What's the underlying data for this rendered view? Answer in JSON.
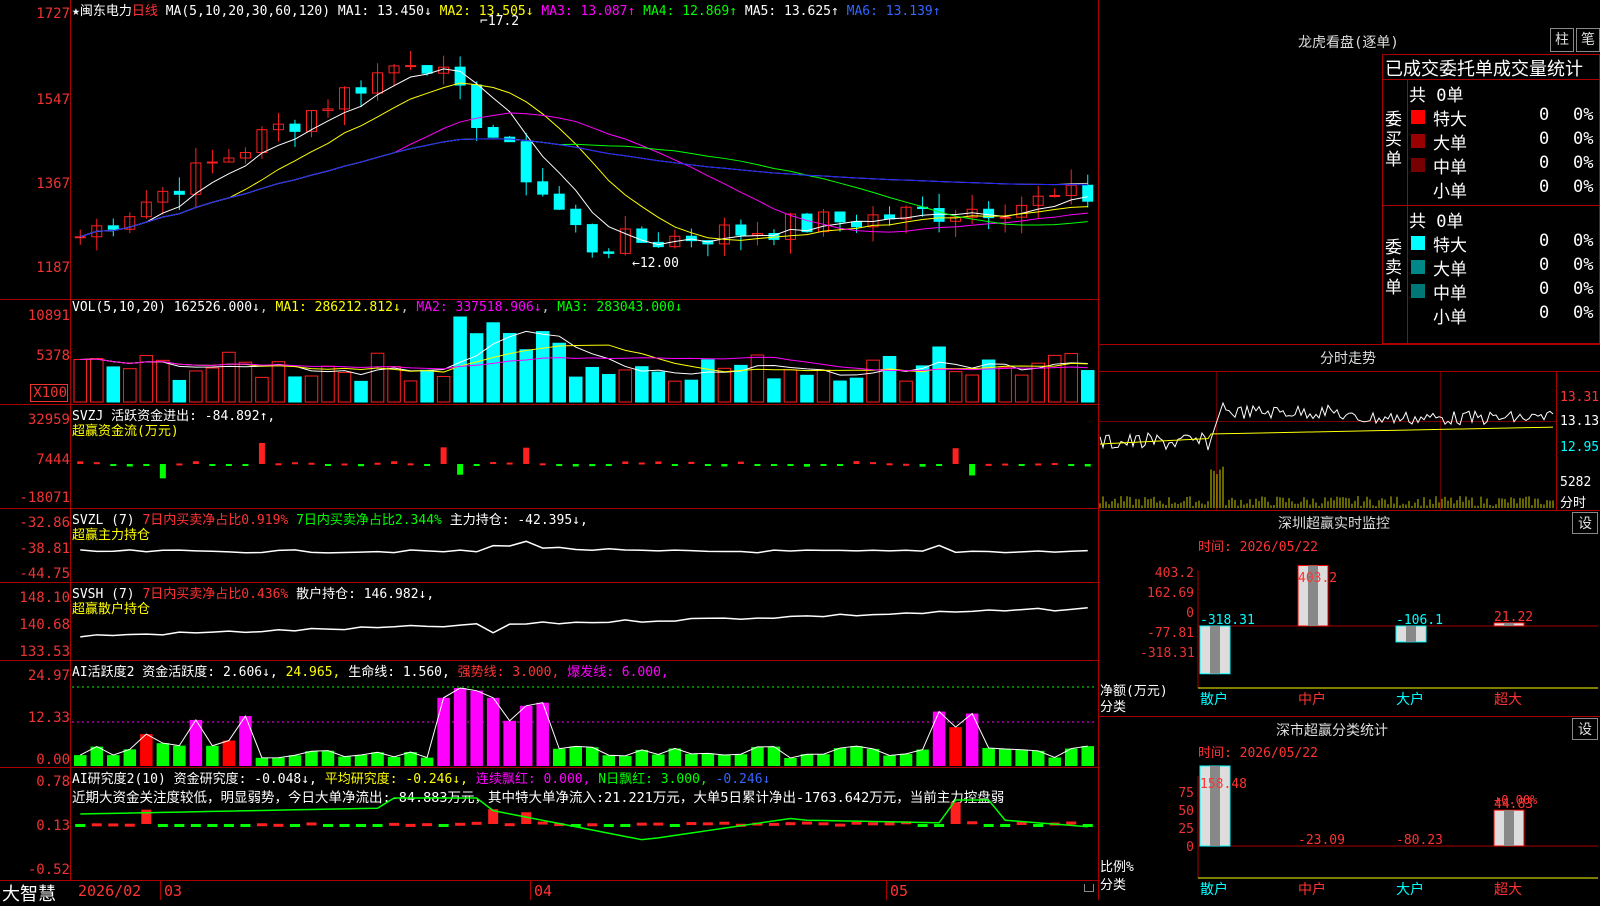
{
  "stock": {
    "star": "★",
    "name": "闽东电力",
    "period": "日线"
  },
  "ma_header": {
    "label": "MA(5,10,20,30,60,120)",
    "ma1": "MA1: 13.450↓",
    "ma2": "MA2: 13.505↓",
    "ma3": "MA3: 13.087↑",
    "ma4": "MA4: 12.869↑",
    "ma5": "MA5: 13.625↑",
    "ma6": "MA6: 13.139↑"
  },
  "price_axis": [
    "1727",
    "1547",
    "1367",
    "1187"
  ],
  "price_marks": {
    "high": "17.2",
    "low": "12.00"
  },
  "vol_header": {
    "label": "VOL(5,10,20)",
    "val": "162526.000↓",
    "ma1": "MA1: 286212.812↓",
    "ma2": "MA2: 337518.906↓",
    "ma3": "MA3: 283043.000↓"
  },
  "vol_axis": [
    "10891",
    "5378",
    "X100"
  ],
  "svzj_header": {
    "label": "SVZJ  活跃资金进出: -84.892↑,",
    "sub": "超赢资金流(万元)"
  },
  "svzj_axis": [
    "32959",
    "7444",
    "-18071"
  ],
  "svzl_header": {
    "label": "SVZL (7)",
    "p1": "7日内买卖净占比0.919%",
    "p2": "7日内买卖净占比2.344%",
    "p3": "主力持仓: -42.395↓,",
    "sub": "超赢主力持仓"
  },
  "svzl_axis": [
    "-32.86",
    "-38.81",
    "-44.75"
  ],
  "svsh_header": {
    "label": "SVSH (7)",
    "p1": "7日内买卖净占比0.436%",
    "p2": "散户持仓: 146.982↓,",
    "sub": "超赢散户持仓"
  },
  "svsh_axis": [
    "148.10",
    "140.68",
    "133.53"
  ],
  "ai1_header": {
    "label": "AI活跃度2 资金活跃度: 2.606↓,",
    "v2": "24.965,",
    "v3": "生命线: 1.560,",
    "v4": "强势线: 3.000,",
    "v5": "爆发线: 6.000,"
  },
  "ai1_axis": [
    "24.97",
    "12.33",
    "0.00"
  ],
  "ai2_header": {
    "label": "AI研究度2(10) 资金研究度: -0.048↓,",
    "v2": "平均研究度: -0.246↓,",
    "v3": "连续飘红: 0.000,",
    "v4": "N日飘红: 3.000,",
    "v5": "-0.246↓"
  },
  "ai2_text": "近期大资金关注度较低，明显弱势，今日大单净流出:-84.883万元，其中特大单净流入:21.221万元，大单5日累计净出-1763.642万元，当前主力控盘弱",
  "ai2_axis": [
    "0.78",
    "0.13",
    "-0.52"
  ],
  "bottom": {
    "brand": "大智慧",
    "date": "2026/02",
    "m03": "03",
    "m04": "04",
    "m05": "05"
  },
  "lhb": {
    "title": "龙虎看盘(逐单)",
    "btn1": "柱",
    "btn2": "笔",
    "subtitle": "已成交委托单成交量统计",
    "buy_label": "委买单",
    "sell_label": "委卖单",
    "buy_total": "共 0单",
    "sell_total": "共 0单",
    "buy_rows": [
      {
        "name": "特大",
        "n": "0",
        "p": "0%"
      },
      {
        "name": "大单",
        "n": "0",
        "p": "0%"
      },
      {
        "name": "中单",
        "n": "0",
        "p": "0%"
      },
      {
        "name": "小单",
        "n": "0",
        "p": "0%"
      }
    ],
    "sell_rows": [
      {
        "name": "特大",
        "n": "0",
        "p": "0%"
      },
      {
        "name": "大单",
        "n": "0",
        "p": "0%"
      },
      {
        "name": "中单",
        "n": "0",
        "p": "0%"
      },
      {
        "name": "小单",
        "n": "0",
        "p": "0%"
      }
    ]
  },
  "intraday": {
    "title": "分时走势",
    "p1": "13.31",
    "p2": "13.13",
    "p3": "12.95",
    "vol": "5282",
    "label": "分时"
  },
  "szmon": {
    "title": "深圳超赢实时监控",
    "btn": "设",
    "date": "时间: 2026/05/22",
    "axis": [
      "403.2",
      "162.69",
      "0",
      "-77.81",
      "-318.31"
    ],
    "unit": "净额(万元)",
    "cat_label": "分类",
    "bars": [
      {
        "cat": "散户",
        "val": "-318.31",
        "v": -318.31
      },
      {
        "cat": "中户",
        "val": "403.2",
        "v": 403.2
      },
      {
        "cat": "大户",
        "val": "-106.1",
        "v": -106.1
      },
      {
        "cat": "超大",
        "val": "21.22",
        "v": 21.22
      }
    ]
  },
  "szcls": {
    "title": "深市超赢分类统计",
    "btn": "设",
    "date": "时间: 2026/05/22",
    "axis": [
      "75",
      "50",
      "25",
      "0"
    ],
    "unit": "比例%",
    "cat_label": "分类",
    "note": "+0.00%",
    "bars": [
      {
        "cat": "散户",
        "val": "158.48",
        "v": 100
      },
      {
        "cat": "中户",
        "val": "-23.09",
        "v": 0
      },
      {
        "cat": "大户",
        "val": "-80.23",
        "v": 0
      },
      {
        "cat": "超大",
        "val": "44.83",
        "v": 44.83
      }
    ]
  },
  "colors": {
    "up": "#ff2020",
    "down": "#00ffff",
    "ma1": "#ffffff",
    "ma2": "#ffff00",
    "ma3": "#ff00ff",
    "ma4": "#00ff00",
    "ma5": "#c0c0c0",
    "ma6": "#2020ff"
  }
}
